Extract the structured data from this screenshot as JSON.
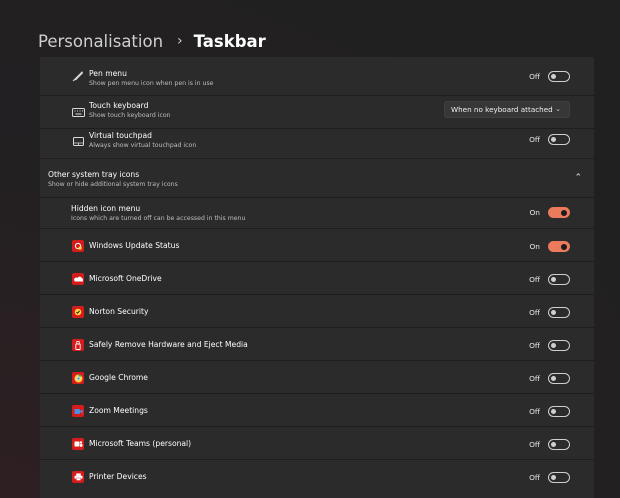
{
  "breadcrumb": {
    "parent": "Personalisation",
    "separator": "›",
    "current": "Taskbar"
  },
  "pen_settings": [
    {
      "label": "Pen menu",
      "description": "Show pen menu icon when pen is in use",
      "state": "Off"
    },
    {
      "label": "Touch keyboard",
      "description": "Show touch keyboard icon",
      "dropdown_value": "When no keyboard attached",
      "chevron": "⌄"
    },
    {
      "label": "Virtual touchpad",
      "description": "Always show virtual touchpad icon",
      "state": "Off"
    }
  ],
  "tray_section": {
    "title": "Other system tray icons",
    "description": "Show or hide additional system tray icons",
    "expander": "⌃"
  },
  "hidden_menu": {
    "label": "Hidden icon menu",
    "description": "Icons which are turned off can be accessed in this menu",
    "state": "On"
  },
  "tray_icons": [
    {
      "label": "Windows Update Status",
      "state": "On",
      "icon": "windows-update-icon"
    },
    {
      "label": "Microsoft OneDrive",
      "state": "Off",
      "icon": "onedrive-icon"
    },
    {
      "label": "Norton Security",
      "state": "Off",
      "icon": "norton-icon"
    },
    {
      "label": "Safely Remove Hardware and Eject Media",
      "state": "Off",
      "icon": "usb-eject-icon"
    },
    {
      "label": "Google Chrome",
      "state": "Off",
      "icon": "chrome-icon"
    },
    {
      "label": "Zoom Meetings",
      "state": "Off",
      "icon": "zoom-icon"
    },
    {
      "label": "Microsoft Teams (personal)",
      "state": "Off",
      "icon": "teams-icon"
    },
    {
      "label": "Printer Devices",
      "state": "Off",
      "icon": "printer-icon"
    }
  ],
  "colors": {
    "accent": "#ec7a5d",
    "app_icon_red": "#d51c1c",
    "card": "#2b2b2b"
  }
}
